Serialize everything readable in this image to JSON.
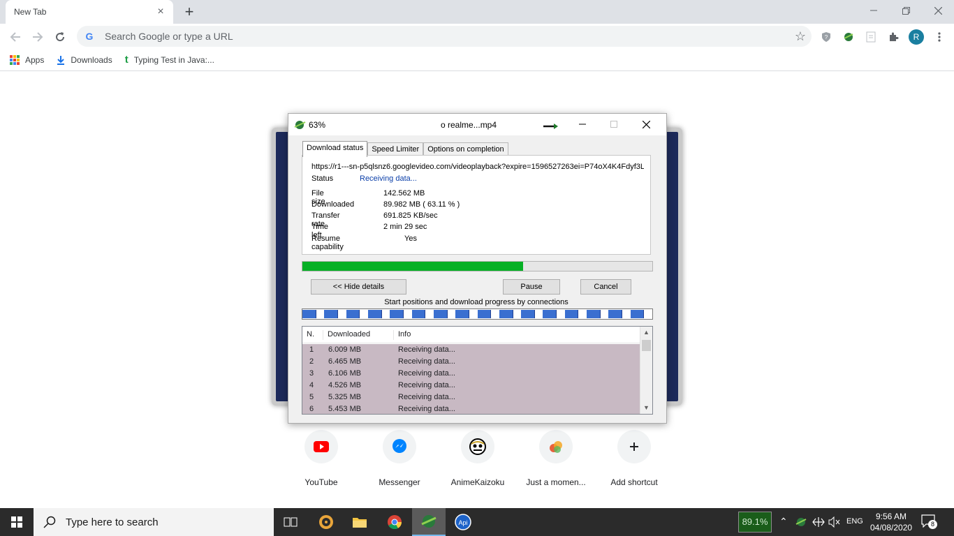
{
  "browser": {
    "tab_title": "New Tab",
    "omnibox_placeholder": "Search Google or type a URL",
    "profile_initial": "R",
    "bookmarks": [
      {
        "label": "Apps",
        "icon": "apps-grid-icon"
      },
      {
        "label": "Downloads",
        "icon": "download-icon"
      },
      {
        "label": "Typing Test in Java:...",
        "icon": "t-logo-icon"
      }
    ]
  },
  "shortcuts": [
    {
      "label": "YouTube",
      "icon": "youtube-icon",
      "color": "#ff0000"
    },
    {
      "label": "Messenger",
      "icon": "messenger-icon",
      "color": "#0084ff"
    },
    {
      "label": "AnimeKaizoku",
      "icon": "anime-icon",
      "color": "#000000"
    },
    {
      "label": "Just a momen...",
      "icon": "just-a-moment-icon",
      "color": "#e8603c"
    },
    {
      "label": "Add shortcut",
      "icon": "plus-icon",
      "color": "#202124"
    }
  ],
  "dialog": {
    "title_percent": "63%",
    "title_filename": "o realme...mp4",
    "tabs": [
      "Download status",
      "Speed Limiter",
      "Options on completion"
    ],
    "active_tab": 0,
    "url": "https://r1---sn-p5qlsnz6.googlevideo.com/videoplayback?expire=1596527263ei=P74oX4K4Fdyf3L",
    "status_label": "Status",
    "status_value": "Receiving data...",
    "file_size_label": "File size",
    "file_size_value": "142.562  MB",
    "downloaded_label": "Downloaded",
    "downloaded_value": "89.982  MB  ( 63.11 % )",
    "transfer_rate_label": "Transfer rate",
    "transfer_rate_value": "691.825  KB/sec",
    "time_left_label": "Time left",
    "time_left_value": "2 min 29 sec",
    "resume_label": "Resume capability",
    "resume_value": "Yes",
    "progress_fraction": 0.6311,
    "hide_details_label": "<< Hide details",
    "pause_label": "Pause",
    "cancel_label": "Cancel",
    "connections_label": "Start positions and download progress by connections",
    "connection_segments_count": 16,
    "list_headers": [
      "N.",
      "Downloaded",
      "Info"
    ],
    "connections": [
      {
        "n": "1",
        "downloaded": "6.009  MB",
        "info": "Receiving data..."
      },
      {
        "n": "2",
        "downloaded": "6.465  MB",
        "info": "Receiving data..."
      },
      {
        "n": "3",
        "downloaded": "6.106  MB",
        "info": "Receiving data..."
      },
      {
        "n": "4",
        "downloaded": "4.526  MB",
        "info": "Receiving data..."
      },
      {
        "n": "5",
        "downloaded": "5.325  MB",
        "info": "Receiving data..."
      },
      {
        "n": "6",
        "downloaded": "5.453  MB",
        "info": "Receiving data..."
      }
    ]
  },
  "taskbar": {
    "search_placeholder": "Type here to search",
    "meter_value": "89.1%",
    "language": "ENG",
    "time": "9:56 AM",
    "date": "04/08/2020",
    "notification_count": "8"
  }
}
